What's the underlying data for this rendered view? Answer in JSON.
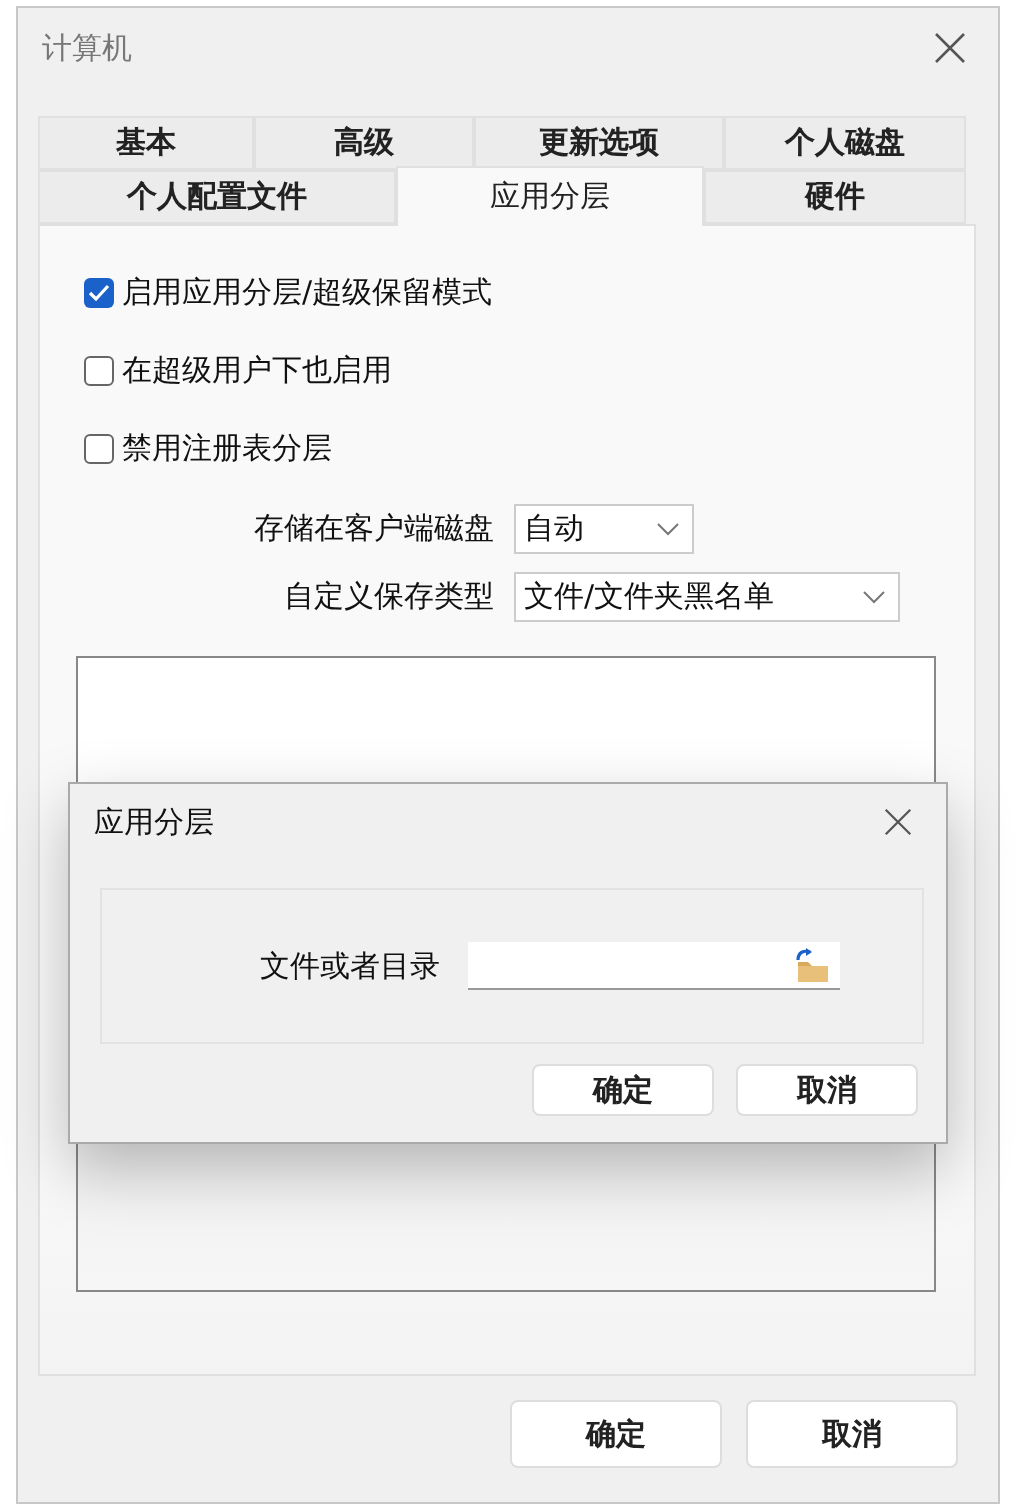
{
  "window": {
    "title": "计算机"
  },
  "tab_rows": [
    [
      {
        "label": "基本",
        "selected": false
      },
      {
        "label": "高级",
        "selected": false
      },
      {
        "label": "更新选项",
        "selected": false
      },
      {
        "label": "个人磁盘",
        "selected": false
      }
    ],
    [
      {
        "label": "个人配置文件",
        "selected": false
      },
      {
        "label": "应用分层",
        "selected": true
      },
      {
        "label": "硬件",
        "selected": false
      }
    ]
  ],
  "checkboxes": [
    {
      "label": "启用应用分层/超级保留模式",
      "checked": true
    },
    {
      "label": "在超级用户下也启用",
      "checked": false
    },
    {
      "label": "禁用注册表分层",
      "checked": false
    }
  ],
  "dropdowns": [
    {
      "label": "存储在客户端磁盘",
      "value": "自动"
    },
    {
      "label": "自定义保存类型",
      "value": "文件/文件夹黑名单"
    }
  ],
  "dialog": {
    "title": "应用分层",
    "field_label": "文件或者目录",
    "buttons": [
      "确定",
      "取消"
    ]
  },
  "buttons": [
    "确定",
    "取消"
  ]
}
